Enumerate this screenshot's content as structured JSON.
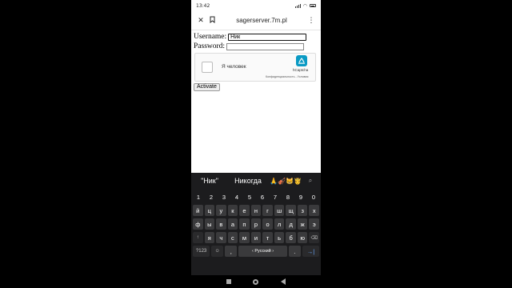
{
  "status": {
    "time": "13:42"
  },
  "browser": {
    "url": "sagerserver.7m.pl",
    "close_icon": "close-icon",
    "bookmark_icon": "bookmark-icon",
    "menu_icon": "more-vert-icon"
  },
  "form": {
    "username_label": "Username:",
    "username_value": "Ник",
    "password_label": "Password:",
    "password_value": "",
    "captcha": {
      "label": "Я человек",
      "brand": "hCaptcha",
      "privacy": "Конфиденциальность - Условия",
      "checked": false
    },
    "activate_label": "Activate"
  },
  "keyboard": {
    "suggestions": [
      "\"Ник\"",
      "Никогда",
      "🙏🎻😸🤴"
    ],
    "number_row": [
      "1",
      "2",
      "3",
      "4",
      "5",
      "6",
      "7",
      "8",
      "9",
      "0"
    ],
    "row1": [
      "й",
      "ц",
      "у",
      "к",
      "е",
      "н",
      "г",
      "ш",
      "щ",
      "з",
      "х"
    ],
    "row2": [
      "ф",
      "ы",
      "в",
      "а",
      "п",
      "р",
      "о",
      "л",
      "д",
      "ж",
      "э"
    ],
    "row3": [
      "↑",
      "я",
      "ч",
      "с",
      "м",
      "и",
      "т",
      "ь",
      "б",
      "ю",
      "⌫"
    ],
    "bottom": {
      "symbols": "?123",
      "emoji": "☺",
      "comma": ",",
      "space": "‹ Русский ›",
      "period": ".",
      "enter": "→|"
    }
  },
  "colors": {
    "page_bg": "#000000",
    "keyboard_bg": "#1c1c1e",
    "key_bg": "#3a3a3c",
    "accent": "#6aa8ff"
  }
}
